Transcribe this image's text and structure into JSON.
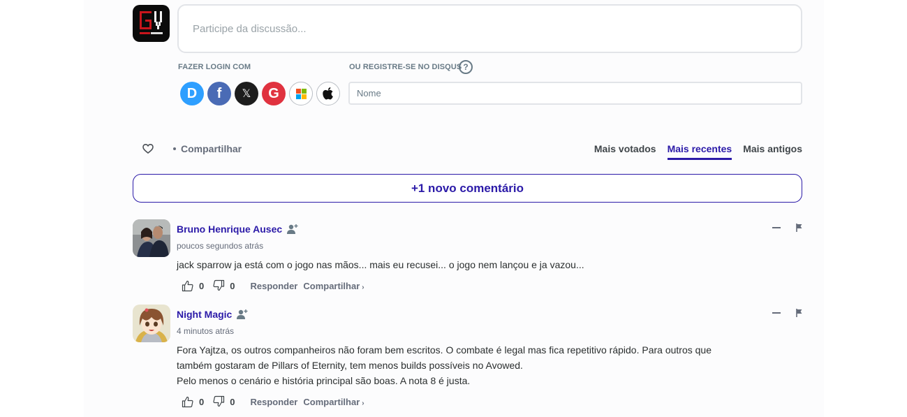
{
  "composer": {
    "placeholder": "Participe da discussão...",
    "site_logo": "gv-logo"
  },
  "login": {
    "label": "FAZER LOGIN COM",
    "providers": [
      {
        "name": "Disqus",
        "icon": "disqus-icon",
        "glyph": "D",
        "color": "#2e9fff"
      },
      {
        "name": "Facebook",
        "icon": "facebook-icon",
        "glyph": "f",
        "color": "#4a6bb5"
      },
      {
        "name": "X",
        "icon": "x-icon",
        "glyph": "𝕏",
        "color": "#1d1d1d"
      },
      {
        "name": "Google",
        "icon": "google-icon",
        "glyph": "G",
        "color": "#e0323f"
      },
      {
        "name": "Microsoft",
        "icon": "microsoft-icon",
        "glyph": "",
        "color": "#ffffff"
      },
      {
        "name": "Apple",
        "icon": "apple-icon",
        "glyph": "",
        "color": "#ffffff"
      }
    ]
  },
  "register": {
    "label": "OU REGISTRE-SE NO DISQUS",
    "help_glyph": "?",
    "name_placeholder": "Nome"
  },
  "toolbar": {
    "share_label": "Compartilhar",
    "sort_tabs": [
      {
        "label": "Mais votados",
        "active": false
      },
      {
        "label": "Mais recentes",
        "active": true
      },
      {
        "label": "Mais antigos",
        "active": false
      }
    ]
  },
  "new_comments_button": "+1 novo comentário",
  "accent_color": "#2b1aa8",
  "comments": [
    {
      "author": "Bruno Henrique Ausec",
      "timestamp": "poucos segundos atrás",
      "body": [
        "jack sparrow ja está com o jogo nas mãos... mais eu recusei... o jogo nem lançou e ja vazou..."
      ],
      "upvotes": "0",
      "downvotes": "0",
      "reply_label": "Responder",
      "share_label": "Compartilhar",
      "share_chevron": "›"
    },
    {
      "author": "Night Magic",
      "timestamp": "4 minutos atrás",
      "body": [
        "Fora Yajtza, os outros companheiros não foram bem escritos. O combate é legal mas fica repetitivo rápido. Para outros que",
        "também gostaram de Pillars of Eternity, tem menos builds possíveis no Avowed.",
        "Pelo menos o cenário e história principal são boas. A nota 8 é justa."
      ],
      "upvotes": "0",
      "downvotes": "0",
      "reply_label": "Responder",
      "share_label": "Compartilhar",
      "share_chevron": "›"
    }
  ]
}
